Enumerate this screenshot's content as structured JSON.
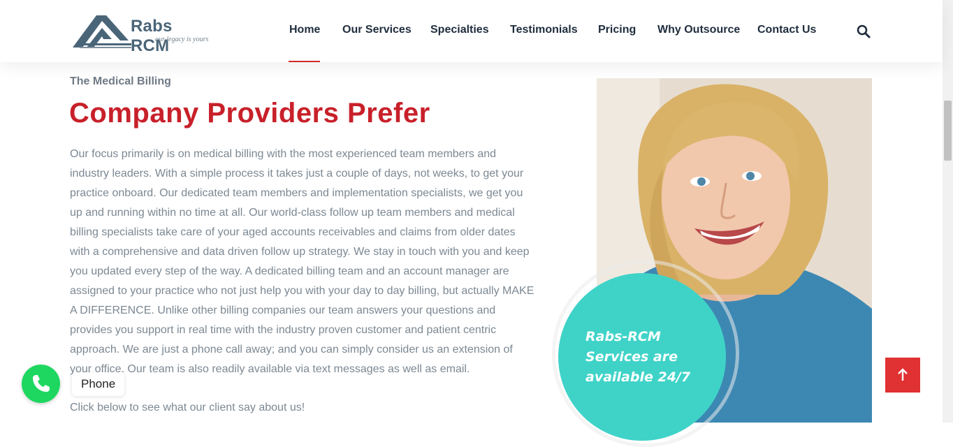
{
  "header": {
    "logo_name": "Rabs RCM",
    "logo_tagline": "our legacy is yours",
    "nav": [
      {
        "label": "Home",
        "active": true
      },
      {
        "label": "Our Services"
      },
      {
        "label": "Specialties"
      },
      {
        "label": "Testimonials"
      },
      {
        "label": "Pricing"
      },
      {
        "label": "Why Outsource"
      },
      {
        "label": "Contact Us"
      }
    ],
    "search_icon": "search-icon"
  },
  "content": {
    "eyebrow": "The Medical Billing",
    "headline": "Company Providers Prefer",
    "body": "Our focus primarily is on medical billing with the most experienced team members and industry leaders. With a simple process it takes just a couple of days, not weeks, to get your practice onboard. Our dedicated team members and implementation specialists, we get you up and running within no time at all. Our world-class follow up team members and medical billing specialists take care of your aged accounts receivables and claims from older dates with a comprehensive and data driven follow up strategy. We stay in touch with you and keep you updated every step of the way. A dedicated billing team and an account manager are assigned to your practice who not just help you with your day to day billing, but actually MAKE A DIFFERENCE. Unlike other billing companies our team answers your questions and provides you support in real time with the industry proven customer and patient centric approach. We are just a phone call away; and you can simply consider us an extension of your office. Our team is also readily available via text messages as well as email.",
    "cta": "Click below to see what our client say about us!"
  },
  "hero": {
    "badge_text": "Rabs-RCM Services are available 24/7"
  },
  "floating": {
    "phone_label": "Phone",
    "phone_icon": "phone-icon",
    "back_to_top_icon": "arrow-up-icon"
  },
  "colors": {
    "accent_red": "#c8202a",
    "teal": "#3fd3c8",
    "phone_green": "#1ed760",
    "nav_text": "#1f2d3d",
    "body_text": "#7c8893"
  }
}
